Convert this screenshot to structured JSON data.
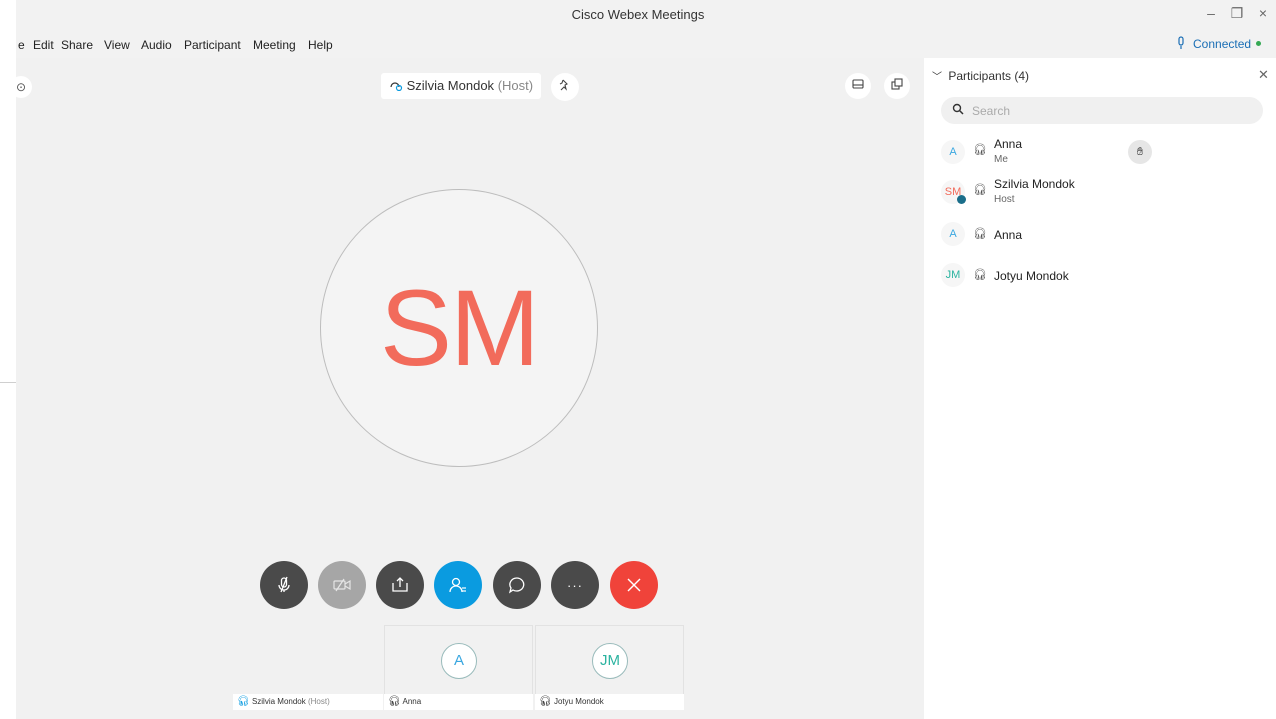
{
  "window": {
    "title": "Cisco Webex Meetings",
    "minimize_label": "–",
    "restore_label": "❐",
    "close_label": "×"
  },
  "menu": {
    "items": [
      {
        "label": "e"
      },
      {
        "label": "Edit"
      },
      {
        "label": "Share"
      },
      {
        "label": "View"
      },
      {
        "label": "Audio"
      },
      {
        "label": "Participant"
      },
      {
        "label": "Meeting"
      },
      {
        "label": "Help"
      }
    ],
    "status": "Connected",
    "status_color": "#34a853"
  },
  "stage": {
    "speaker_name": "Szilvia Mondok",
    "speaker_role": "(Host)",
    "speaker_initials": "SM",
    "speaker_color": "#f26b5b",
    "controls": [
      {
        "name": "mute",
        "color": "#4a4a4a"
      },
      {
        "name": "video-off",
        "color": "#a6a6a6"
      },
      {
        "name": "share",
        "color": "#4a4a4a"
      },
      {
        "name": "participants",
        "color": "#0a9be0"
      },
      {
        "name": "chat",
        "color": "#4a4a4a"
      },
      {
        "name": "more",
        "color": "#4a4a4a"
      },
      {
        "name": "leave",
        "color": "#f0433a"
      }
    ],
    "more_label": "···",
    "thumbnails": [
      {
        "initials": "",
        "label": "Szilvia Mondok",
        "role": "(Host)"
      },
      {
        "initials": "A",
        "label": "Anna",
        "role": ""
      },
      {
        "initials": "JM",
        "label": "Jotyu Mondok",
        "role": ""
      }
    ]
  },
  "participants_panel": {
    "title": "Participants (4)",
    "search_placeholder": "Search",
    "participants": [
      {
        "initials": "A",
        "name": "Anna",
        "sub": "Me",
        "color": "#3aa7e0"
      },
      {
        "initials": "SM",
        "name": "Szilvia Mondok",
        "sub": "Host",
        "color": "#f26b5b"
      },
      {
        "initials": "A",
        "name": "Anna",
        "sub": "",
        "color": "#3aa7e0"
      },
      {
        "initials": "JM",
        "name": "Jotyu Mondok",
        "sub": "",
        "color": "#2bb3a0"
      }
    ]
  }
}
